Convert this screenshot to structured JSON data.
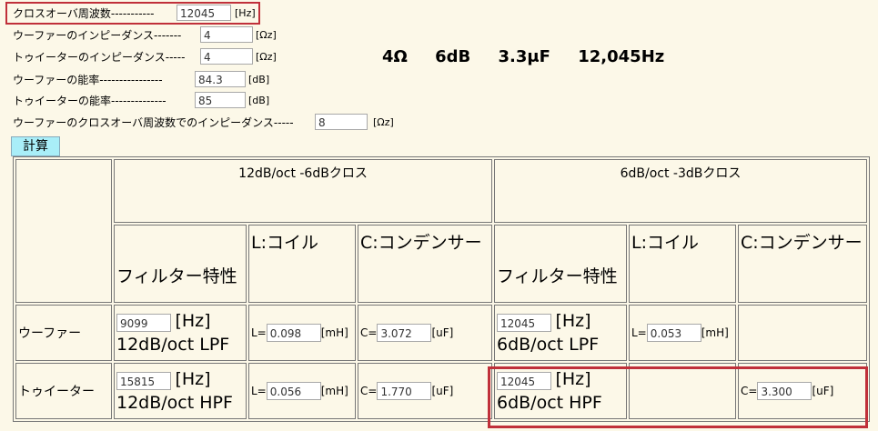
{
  "form": {
    "crossover": {
      "label": "クロスオーバ周波数-----------",
      "value": "12045",
      "unit": "[Hz]"
    },
    "woofer_imp": {
      "label": "ウーファーのインピーダンス-------",
      "value": "4",
      "unit": "[Ωz]"
    },
    "tweeter_imp": {
      "label": "トゥイーターのインピーダンス-----",
      "value": "4",
      "unit": "[Ωz]"
    },
    "woofer_eff": {
      "label": "ウーファーの能率----------------",
      "value": "84.3",
      "unit": "[dB]"
    },
    "tweeter_eff": {
      "label": "トゥイーターの能率--------------",
      "value": "85",
      "unit": "[dB]"
    },
    "woofer_ximp": {
      "label": "ウーファーのクロスオーバ周波数でのインピーダンス-----",
      "value": "8",
      "unit": "[Ωz]"
    }
  },
  "summary": {
    "imp": "4Ω",
    "atten": "6dB",
    "cap": "3.3μF",
    "freq": "12,045Hz"
  },
  "calc_button": "計算",
  "table": {
    "group1": "12dB/oct -6dBクロス",
    "group2": "6dB/oct -3dBクロス",
    "col_filter": "フィルター特性",
    "col_coil": "L:コイル",
    "col_cap": "C:コンデンサー",
    "rows": {
      "woofer": {
        "label": "ウーファー",
        "g1_freq": "9099",
        "g1_type": "12dB/oct LPF",
        "g1_L": "0.098",
        "g1_C": "3.072",
        "g2_freq": "12045",
        "g2_type": "6dB/oct LPF",
        "g2_L": "0.053"
      },
      "tweeter": {
        "label": "トゥイーター",
        "g1_freq": "15815",
        "g1_type": "12dB/oct HPF",
        "g1_L": "0.056",
        "g1_C": "1.770",
        "g2_freq": "12045",
        "g2_type": "6dB/oct HPF",
        "g2_C": "3.300"
      }
    },
    "units": {
      "hz": "[Hz]",
      "mh": "[mH]",
      "uf": "[uF]",
      "l_prefix": "L=",
      "c_prefix": "C="
    }
  }
}
